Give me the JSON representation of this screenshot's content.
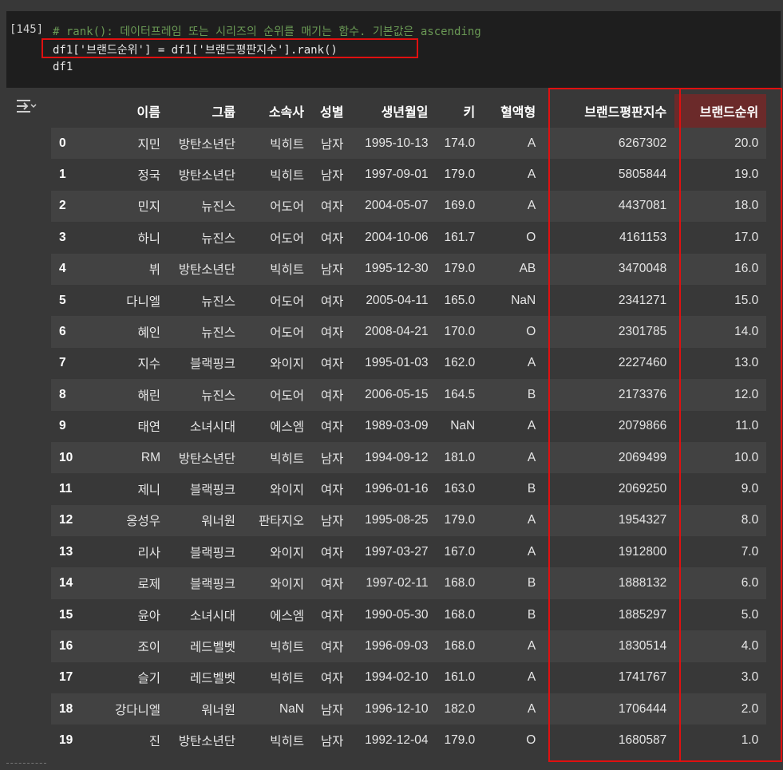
{
  "cell": {
    "execution_count": "[145]",
    "comment_line": "# rank(): 데이터프레임 또는 시리즈의 순위를 매기는 함수. 기본값은 ascending",
    "code_line_1": "df1['브랜드순위'] = df1['브랜드평판지수'].rank()",
    "code_line_2": "df1"
  },
  "output": {
    "icon": "output-toggle-icon"
  },
  "table": {
    "columns": [
      "",
      "이름",
      "그룹",
      "소속사",
      "성별",
      "생년월일",
      "키",
      "혈액형",
      "브랜드평판지수",
      "브랜드순위"
    ],
    "rows": [
      [
        "0",
        "지민",
        "방탄소년단",
        "빅히트",
        "남자",
        "1995-10-13",
        "174.0",
        "A",
        "6267302",
        "20.0"
      ],
      [
        "1",
        "정국",
        "방탄소년단",
        "빅히트",
        "남자",
        "1997-09-01",
        "179.0",
        "A",
        "5805844",
        "19.0"
      ],
      [
        "2",
        "민지",
        "뉴진스",
        "어도어",
        "여자",
        "2004-05-07",
        "169.0",
        "A",
        "4437081",
        "18.0"
      ],
      [
        "3",
        "하니",
        "뉴진스",
        "어도어",
        "여자",
        "2004-10-06",
        "161.7",
        "O",
        "4161153",
        "17.0"
      ],
      [
        "4",
        "뷔",
        "방탄소년단",
        "빅히트",
        "남자",
        "1995-12-30",
        "179.0",
        "AB",
        "3470048",
        "16.0"
      ],
      [
        "5",
        "다니엘",
        "뉴진스",
        "어도어",
        "여자",
        "2005-04-11",
        "165.0",
        "NaN",
        "2341271",
        "15.0"
      ],
      [
        "6",
        "혜인",
        "뉴진스",
        "어도어",
        "여자",
        "2008-04-21",
        "170.0",
        "O",
        "2301785",
        "14.0"
      ],
      [
        "7",
        "지수",
        "블랙핑크",
        "와이지",
        "여자",
        "1995-01-03",
        "162.0",
        "A",
        "2227460",
        "13.0"
      ],
      [
        "8",
        "해린",
        "뉴진스",
        "어도어",
        "여자",
        "2006-05-15",
        "164.5",
        "B",
        "2173376",
        "12.0"
      ],
      [
        "9",
        "태연",
        "소녀시대",
        "에스엠",
        "여자",
        "1989-03-09",
        "NaN",
        "A",
        "2079866",
        "11.0"
      ],
      [
        "10",
        "RM",
        "방탄소년단",
        "빅히트",
        "남자",
        "1994-09-12",
        "181.0",
        "A",
        "2069499",
        "10.0"
      ],
      [
        "11",
        "제니",
        "블랙핑크",
        "와이지",
        "여자",
        "1996-01-16",
        "163.0",
        "B",
        "2069250",
        "9.0"
      ],
      [
        "12",
        "옹성우",
        "워너원",
        "판타지오",
        "남자",
        "1995-08-25",
        "179.0",
        "A",
        "1954327",
        "8.0"
      ],
      [
        "13",
        "리사",
        "블랙핑크",
        "와이지",
        "여자",
        "1997-03-27",
        "167.0",
        "A",
        "1912800",
        "7.0"
      ],
      [
        "14",
        "로제",
        "블랙핑크",
        "와이지",
        "여자",
        "1997-02-11",
        "168.0",
        "B",
        "1888132",
        "6.0"
      ],
      [
        "15",
        "윤아",
        "소녀시대",
        "에스엠",
        "여자",
        "1990-05-30",
        "168.0",
        "B",
        "1885297",
        "5.0"
      ],
      [
        "16",
        "조이",
        "레드벨벳",
        "빅히트",
        "여자",
        "1996-09-03",
        "168.0",
        "A",
        "1830514",
        "4.0"
      ],
      [
        "17",
        "슬기",
        "레드벨벳",
        "빅히트",
        "여자",
        "1994-02-10",
        "161.0",
        "A",
        "1741767",
        "3.0"
      ],
      [
        "18",
        "강다니엘",
        "워너원",
        "NaN",
        "남자",
        "1996-12-10",
        "182.0",
        "A",
        "1706444",
        "2.0"
      ],
      [
        "19",
        "진",
        "방탄소년단",
        "빅히트",
        "남자",
        "1992-12-04",
        "179.0",
        "O",
        "1680587",
        "1.0"
      ]
    ]
  },
  "colors": {
    "highlight": "#e01010",
    "comment": "#6a9955",
    "background": "#383838"
  }
}
